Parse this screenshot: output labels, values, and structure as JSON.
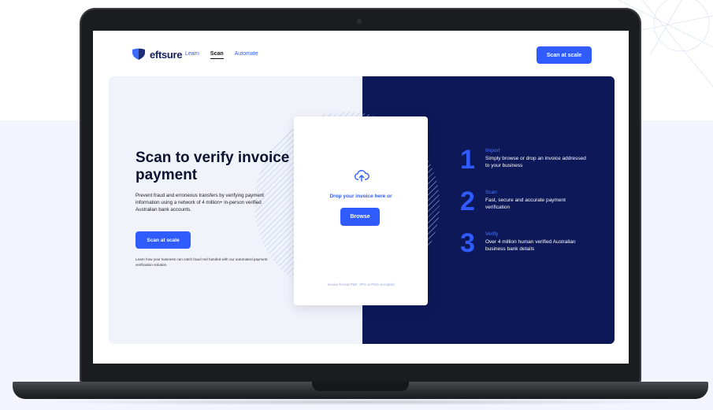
{
  "nav": {
    "brand": "eftsure",
    "links": [
      {
        "label": "Learn",
        "active": false
      },
      {
        "label": "Scan",
        "active": true
      },
      {
        "label": "Automate",
        "active": false
      }
    ],
    "cta": "Scan at scale"
  },
  "hero": {
    "title": "Scan to verify invoice payment",
    "description": "Prevent fraud and erroneous transfers by verifying payment information using a network of 4 million+ in-person verified Australian bank accounts.",
    "cta": "Scan at scale",
    "note": "Learn how your business can catch fraud red handed with our automated payment verification solution."
  },
  "upload": {
    "icon": "cloud-upload-icon",
    "drop_text": "Drop your invoice here or",
    "browse_label": "Browse",
    "format_note": "Invoice format PDF, JPG or PNG accepted"
  },
  "steps": [
    {
      "number": "1",
      "title": "Import",
      "text": "Simply browse or drop an invoice addressed to your business"
    },
    {
      "number": "2",
      "title": "Scan",
      "text": "Fast, secure and accurate payment verification"
    },
    {
      "number": "3",
      "title": "Verify",
      "text": "Over 4 million human verified Australian business bank details"
    }
  ],
  "colors": {
    "accent": "#2f5bff",
    "navy": "#0c1857",
    "page_background": "#f2f5fd"
  }
}
